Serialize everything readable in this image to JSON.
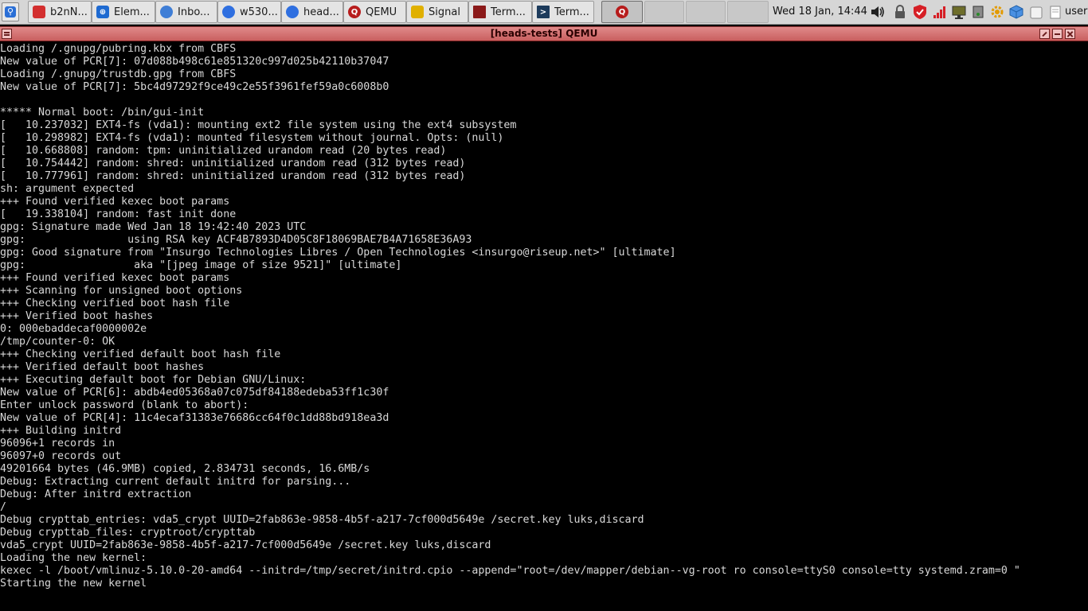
{
  "taskbar": {
    "launcher_icon": "search-icon",
    "tasks": [
      {
        "label": "b2nN...",
        "icon": "red-square-icon",
        "color": "#d32f2f"
      },
      {
        "label": "Elem...",
        "icon": "element-icon",
        "color": "#1e6ad1"
      },
      {
        "label": "Inbo...",
        "icon": "thunderbird-icon",
        "color": "#3f7ed6"
      },
      {
        "label": "w530...",
        "icon": "firefox-icon",
        "color": "#2f6fe0"
      },
      {
        "label": "head...",
        "icon": "firefox-icon",
        "color": "#2f6fe0"
      },
      {
        "label": "QEMU",
        "icon": "qemu-icon",
        "color": "#b71c1c"
      },
      {
        "label": "Signal",
        "icon": "signal-icon",
        "color": "#e0b000"
      },
      {
        "label": "Term...",
        "icon": "terminal-red-icon",
        "color": "#8b1a1a"
      },
      {
        "label": "Term...",
        "icon": "terminal-icon",
        "color": "#1d3b5c"
      },
      {
        "label": "",
        "icon": "qemu-icon",
        "color": "#b71c1c"
      }
    ],
    "clock": "Wed 18 Jan, 14:44",
    "tray_icons": [
      "volume-icon",
      "lock-icon",
      "shield-icon",
      "network-signal-icon",
      "monitor-icon",
      "settings-icon",
      "cube-icon",
      "drive-icon",
      "clipboard-icon"
    ],
    "user_label": "user"
  },
  "window": {
    "title": "[heads-tests] QEMU",
    "menu_icon": "window-menu-icon",
    "buttons": [
      "maximize-button",
      "minimize-button",
      "close-button"
    ]
  },
  "terminal": {
    "lines": [
      "Loading /.gnupg/pubring.kbx from CBFS",
      "New value of PCR[7]: 07d088b498c61e851320c997d025b42110b37047",
      "Loading /.gnupg/trustdb.gpg from CBFS",
      "New value of PCR[7]: 5bc4d97292f9ce49c2e55f3961fef59a0c6008b0",
      "",
      "***** Normal boot: /bin/gui-init",
      "[   10.237032] EXT4-fs (vda1): mounting ext2 file system using the ext4 subsystem",
      "[   10.298982] EXT4-fs (vda1): mounted filesystem without journal. Opts: (null)",
      "[   10.668808] random: tpm: uninitialized urandom read (20 bytes read)",
      "[   10.754442] random: shred: uninitialized urandom read (312 bytes read)",
      "[   10.777961] random: shred: uninitialized urandom read (312 bytes read)",
      "sh: argument expected",
      "+++ Found verified kexec boot params",
      "[   19.338104] random: fast init done",
      "gpg: Signature made Wed Jan 18 19:42:40 2023 UTC",
      "gpg:                using RSA key ACF4B7893D4D05C8F18069BAE7B4A71658E36A93",
      "gpg: Good signature from \"Insurgo Technologies Libres / Open Technologies <insurgo@riseup.net>\" [ultimate]",
      "gpg:                 aka \"[jpeg image of size 9521]\" [ultimate]",
      "+++ Found verified kexec boot params",
      "+++ Scanning for unsigned boot options",
      "+++ Checking verified boot hash file",
      "+++ Verified boot hashes",
      "0: 000ebaddecaf0000002e",
      "/tmp/counter-0: OK",
      "+++ Checking verified default boot hash file",
      "+++ Verified default boot hashes",
      "+++ Executing default boot for Debian GNU/Linux:",
      "New value of PCR[6]: abdb4ed05368a07c075df84188edeba53ff1c30f",
      "Enter unlock password (blank to abort):",
      "New value of PCR[4]: 11c4ecaf31383e76686cc64f0c1dd88bd918ea3d",
      "+++ Building initrd",
      "96096+1 records in",
      "96097+0 records out",
      "49201664 bytes (46.9MB) copied, 2.834731 seconds, 16.6MB/s",
      "Debug: Extracting current default initrd for parsing...",
      "Debug: After initrd extraction",
      "/",
      "Debug crypttab_entries: vda5_crypt UUID=2fab863e-9858-4b5f-a217-7cf000d5649e /secret.key luks,discard",
      "Debug crypttab_files: cryptroot/crypttab",
      "vda5_crypt UUID=2fab863e-9858-4b5f-a217-7cf000d5649e /secret.key luks,discard",
      "Loading the new kernel:",
      "kexec -l /boot/vmlinuz-5.10.0-20-amd64 --initrd=/tmp/secret/initrd.cpio --append=\"root=/dev/mapper/debian--vg-root ro console=ttyS0 console=tty systemd.zram=0 \"",
      "Starting the new kernel"
    ]
  }
}
